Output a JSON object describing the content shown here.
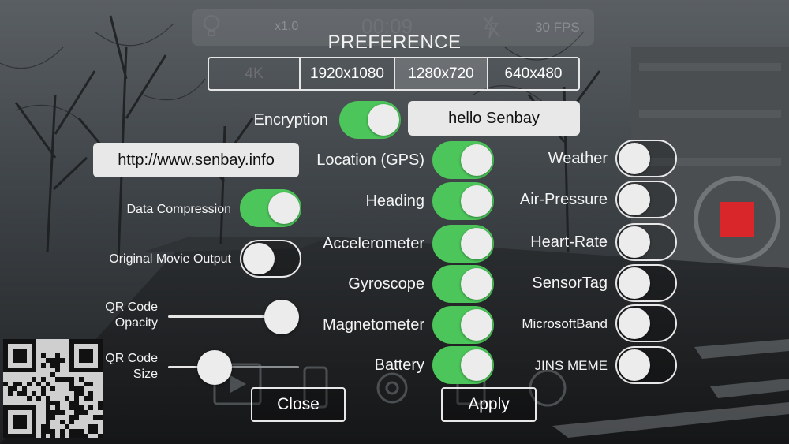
{
  "camera_bar": {
    "zoom": "x1.0",
    "timer": "00:09",
    "fps": "30 FPS",
    "icons": [
      "lightbulb-icon",
      "flash-off-icon"
    ]
  },
  "title": "PREFERENCE",
  "resolution": {
    "options": [
      "4K",
      "1920x1080",
      "1280x720",
      "640x480"
    ],
    "selected": "1280x720",
    "disabled": [
      "4K"
    ]
  },
  "encryption": {
    "label": "Encryption",
    "on": true,
    "key": "hello Senbay"
  },
  "url": "http://www.senbay.info",
  "data_compression": {
    "label": "Data Compression",
    "on": true
  },
  "original_movie_output": {
    "label": "Original Movie Output",
    "on": false
  },
  "qr_opacity": {
    "label_line1": "QR Code",
    "label_line2": "Opacity",
    "value": 1.0
  },
  "qr_size": {
    "label_line1": "QR Code",
    "label_line2": "Size",
    "value": 0.3
  },
  "sensors_left": [
    {
      "label": "Location (GPS)",
      "on": true
    },
    {
      "label": "Heading",
      "on": true
    },
    {
      "label": "Accelerometer",
      "on": true
    },
    {
      "label": "Gyroscope",
      "on": true
    },
    {
      "label": "Magnetometer",
      "on": true
    },
    {
      "label": "Battery",
      "on": true
    }
  ],
  "sensors_right": [
    {
      "label": "Weather",
      "on": false
    },
    {
      "label": "Air-Pressure",
      "on": false
    },
    {
      "label": "Heart-Rate",
      "on": false
    },
    {
      "label": "SensorTag",
      "on": false
    },
    {
      "label": "MicrosoftBand",
      "on": false
    },
    {
      "label": "JINS MEME",
      "on": false
    }
  ],
  "buttons": {
    "close": "Close",
    "apply": "Apply"
  },
  "background_icons": [
    "play-icon",
    "phone-icon",
    "gear-icon",
    "share-icon",
    "help-icon",
    "record-button-icon",
    "qr-code-icon"
  ],
  "colors": {
    "switch_on": "#4cc65a",
    "record": "#d9262b"
  }
}
